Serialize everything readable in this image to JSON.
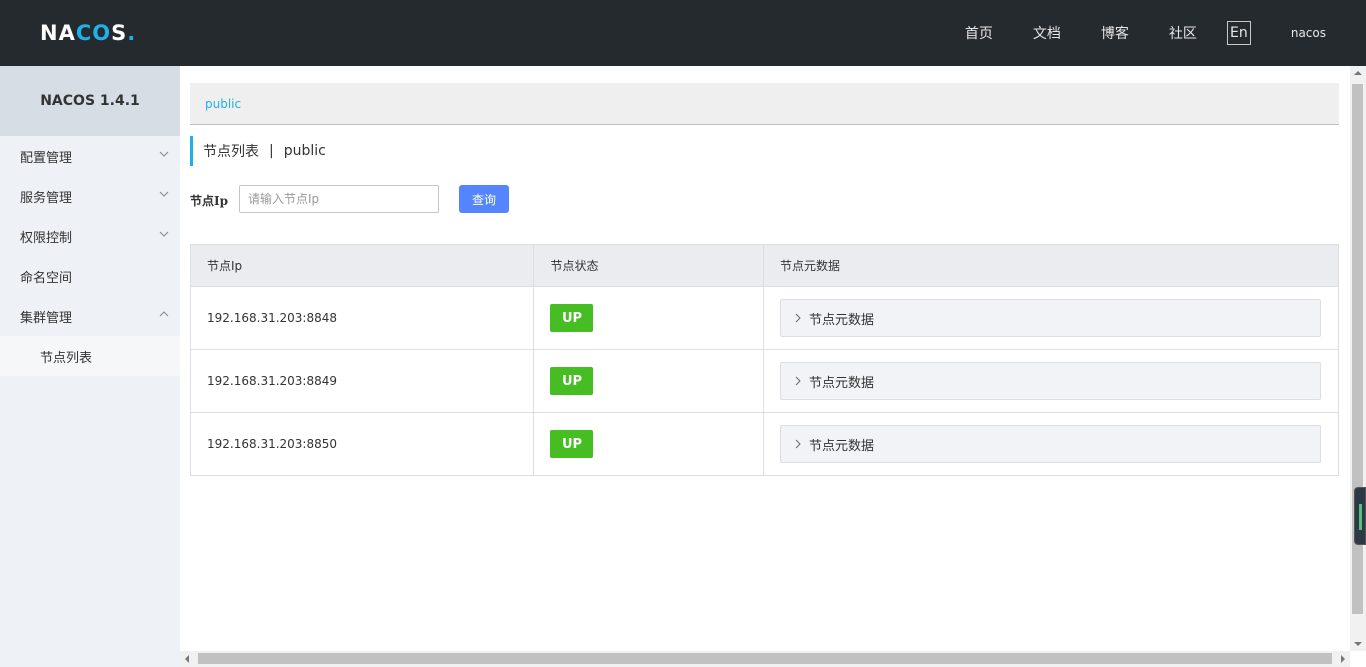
{
  "header": {
    "logo_main": "NA",
    "logo_accent": "CO",
    "logo_tail": "S",
    "logo_dot": ".",
    "nav": [
      "首页",
      "文档",
      "博客",
      "社区"
    ],
    "lang": "En",
    "user": "nacos"
  },
  "sidebar": {
    "title": "NACOS 1.4.1",
    "items": [
      {
        "label": "配置管理",
        "chevron": "down"
      },
      {
        "label": "服务管理",
        "chevron": "down"
      },
      {
        "label": "权限控制",
        "chevron": "down"
      },
      {
        "label": "命名空间",
        "chevron": "none"
      },
      {
        "label": "集群管理",
        "chevron": "up"
      }
    ],
    "sub_item": "节点列表"
  },
  "namespace": "public",
  "page": {
    "title": "节点列表",
    "separator": "|",
    "namespace": "public"
  },
  "search": {
    "label": "节点Ip",
    "placeholder": "请输入节点Ip",
    "button": "查询"
  },
  "table": {
    "headers": [
      "节点Ip",
      "节点状态",
      "节点元数据"
    ],
    "rows": [
      {
        "ip": "192.168.31.203:8848",
        "status": "UP",
        "meta": "节点元数据"
      },
      {
        "ip": "192.168.31.203:8849",
        "status": "UP",
        "meta": "节点元数据"
      },
      {
        "ip": "192.168.31.203:8850",
        "status": "UP",
        "meta": "节点元数据"
      }
    ]
  },
  "colors": {
    "header_bg": "#252a2f",
    "accent": "#1fb0e8",
    "primary_button": "#5584ff",
    "status_up": "#46bd22"
  }
}
